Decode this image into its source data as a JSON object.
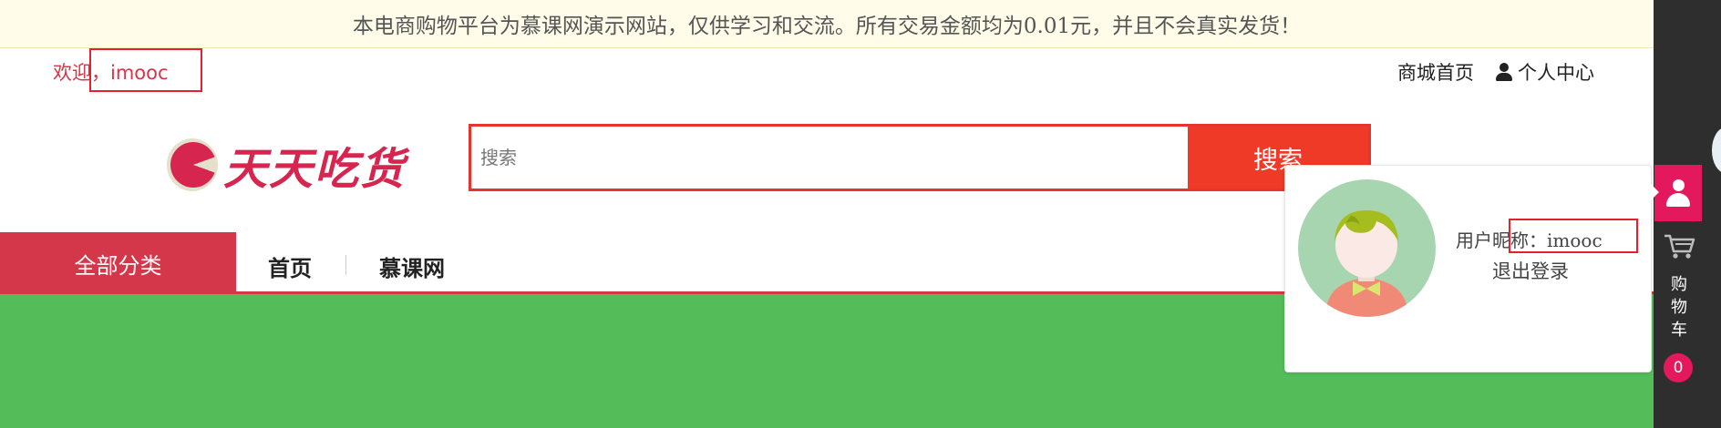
{
  "notice": {
    "text": "本电商购物平台为慕课网演示网站，仅供学习和交流。所有交易金额均为0.01元，并且不会真实发货！"
  },
  "header": {
    "welcome": "欢迎，imooc",
    "links": {
      "home": "商城首页",
      "user_center": "个人中心"
    }
  },
  "logo": {
    "text": "天天吃货",
    "brand_color": "#d6254f"
  },
  "search": {
    "placeholder": "搜索",
    "button_label": "搜索",
    "accent_color": "#ee3a26"
  },
  "nav": {
    "all_categories": "全部分类",
    "items": [
      "首页",
      "慕课网"
    ]
  },
  "banner": {
    "color": "#54bd5a"
  },
  "user_popup": {
    "nickname_label": "用户昵称：",
    "nickname": "imooc",
    "logout": "退出登录"
  },
  "sidebar": {
    "cart_label": "购\n物\n车",
    "cart_count": "0",
    "accent_color": "#e4195d"
  }
}
